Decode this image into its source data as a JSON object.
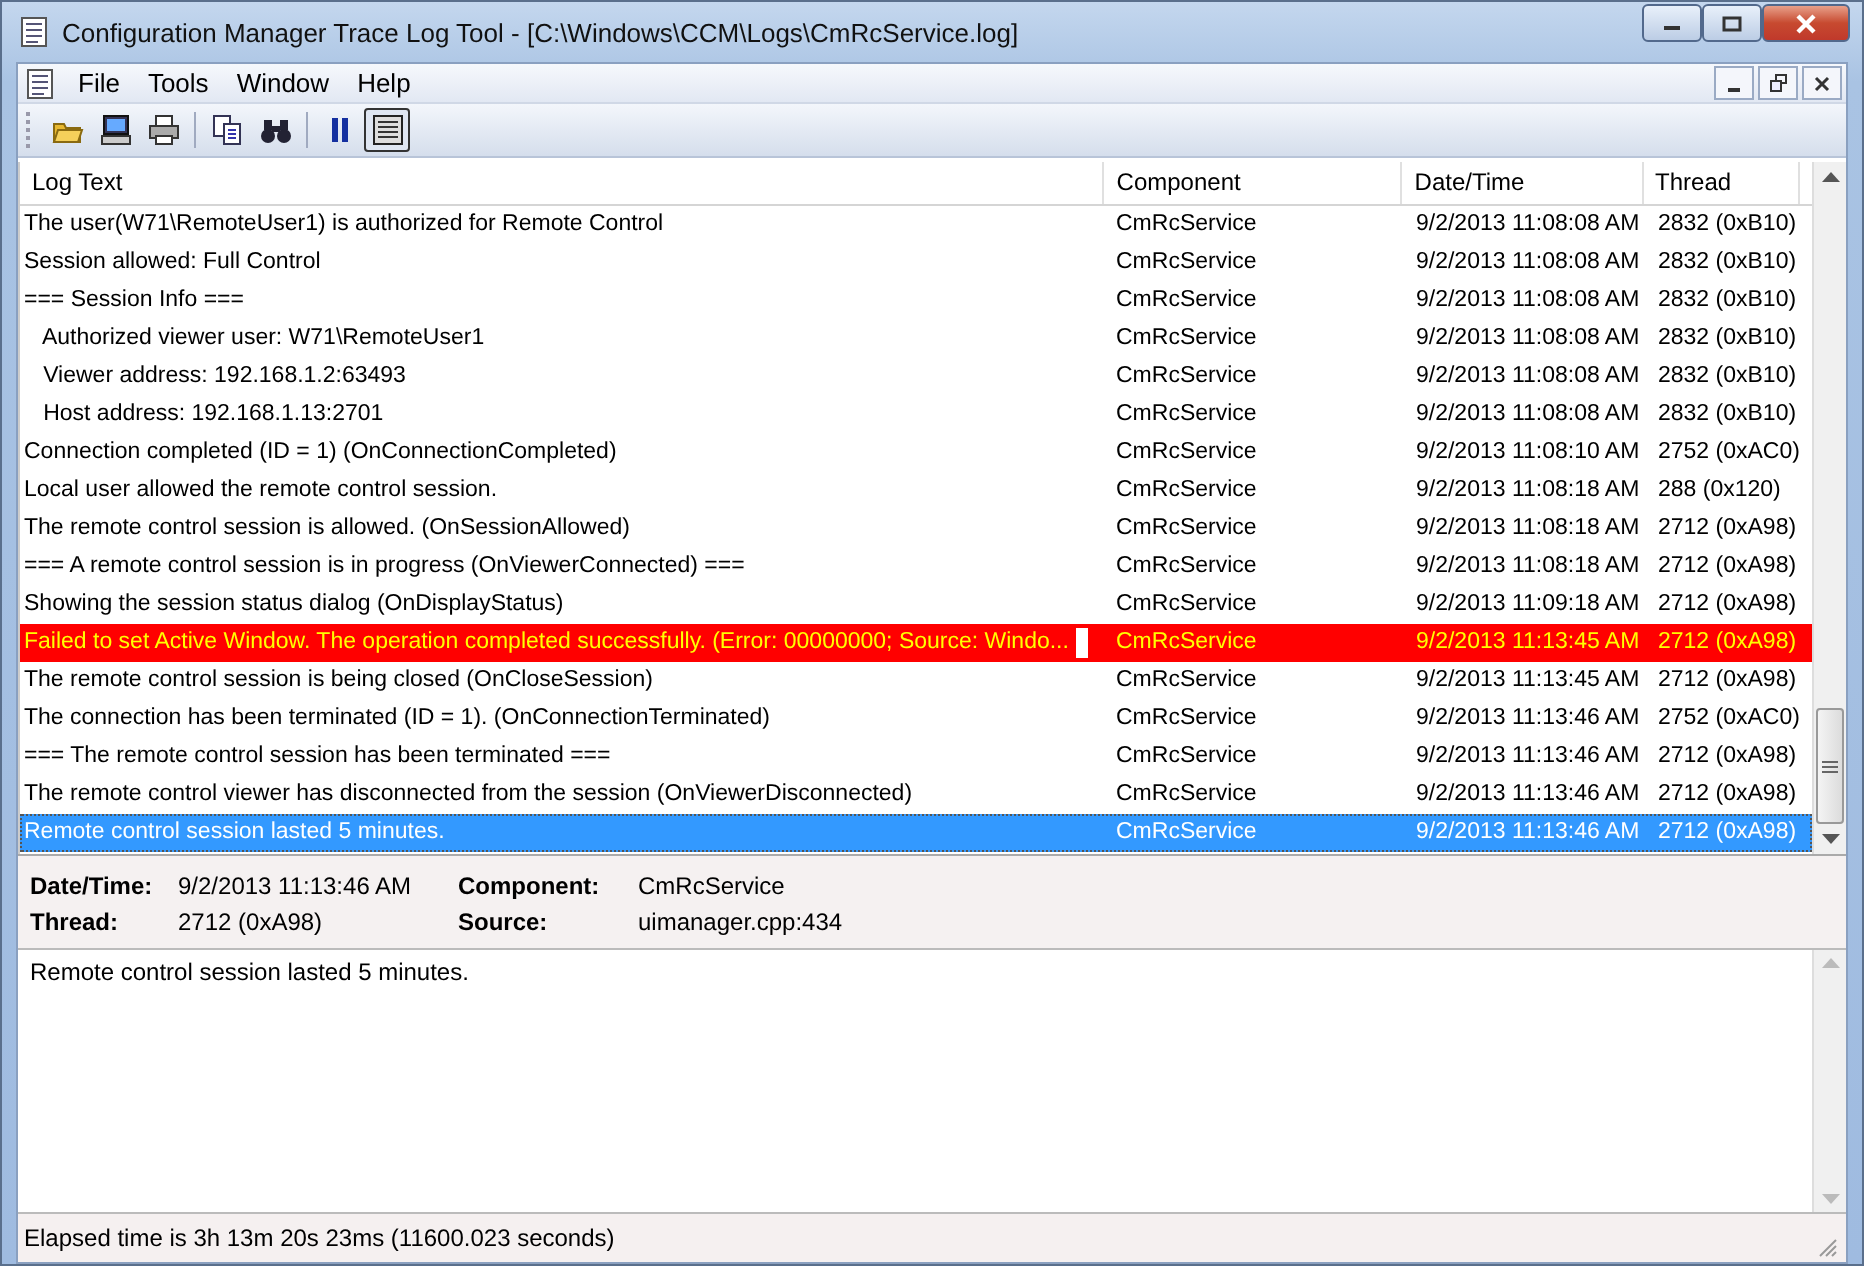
{
  "window": {
    "title": "Configuration Manager Trace Log Tool - [C:\\Windows\\CCM\\Logs\\CmRcService.log]"
  },
  "menu": [
    "File",
    "Tools",
    "Window",
    "Help"
  ],
  "toolbar": [
    {
      "pressed": false
    },
    {
      "pressed": false
    },
    {
      "pressed": false
    },
    {
      "pressed": false
    },
    {
      "pressed": false
    },
    {
      "pressed": false
    },
    {
      "pressed": true
    }
  ],
  "table": {
    "columns": [
      "Log Text",
      "Component",
      "Date/Time",
      "Thread"
    ],
    "rows": [
      {
        "text": "The user(W71\\RemoteUser1) is authorized for Remote Control",
        "component": "CmRcService",
        "datetime": "9/2/2013 11:08:08 AM",
        "thread": "2832 (0xB10)",
        "kind": "normal",
        "selected": false
      },
      {
        "text": "Session allowed: Full Control",
        "component": "CmRcService",
        "datetime": "9/2/2013 11:08:08 AM",
        "thread": "2832 (0xB10)",
        "kind": "normal",
        "selected": false
      },
      {
        "text": "=== Session Info ===",
        "component": "CmRcService",
        "datetime": "9/2/2013 11:08:08 AM",
        "thread": "2832 (0xB10)",
        "kind": "normal",
        "selected": false
      },
      {
        "text": "   Authorized viewer user: W71\\RemoteUser1",
        "component": "CmRcService",
        "datetime": "9/2/2013 11:08:08 AM",
        "thread": "2832 (0xB10)",
        "kind": "normal",
        "selected": false
      },
      {
        "text": "   Viewer address: 192.168.1.2:63493",
        "component": "CmRcService",
        "datetime": "9/2/2013 11:08:08 AM",
        "thread": "2832 (0xB10)",
        "kind": "normal",
        "selected": false
      },
      {
        "text": "   Host address: 192.168.1.13:2701",
        "component": "CmRcService",
        "datetime": "9/2/2013 11:08:08 AM",
        "thread": "2832 (0xB10)",
        "kind": "normal",
        "selected": false
      },
      {
        "text": "Connection completed (ID = 1) (OnConnectionCompleted)",
        "component": "CmRcService",
        "datetime": "9/2/2013 11:08:10 AM",
        "thread": "2752 (0xAC0)",
        "kind": "normal",
        "selected": false
      },
      {
        "text": "Local user allowed the remote control session.",
        "component": "CmRcService",
        "datetime": "9/2/2013 11:08:18 AM",
        "thread": "288 (0x120)",
        "kind": "normal",
        "selected": false
      },
      {
        "text": "The remote control session is allowed. (OnSessionAllowed)",
        "component": "CmRcService",
        "datetime": "9/2/2013 11:08:18 AM",
        "thread": "2712 (0xA98)",
        "kind": "normal",
        "selected": false
      },
      {
        "text": "=== A remote control session is in progress (OnViewerConnected) ===",
        "component": "CmRcService",
        "datetime": "9/2/2013 11:08:18 AM",
        "thread": "2712 (0xA98)",
        "kind": "normal",
        "selected": false
      },
      {
        "text": "Showing the session status dialog (OnDisplayStatus)",
        "component": "CmRcService",
        "datetime": "9/2/2013 11:09:18 AM",
        "thread": "2712 (0xA98)",
        "kind": "normal",
        "selected": false
      },
      {
        "text": "Failed to set Active Window. The operation completed successfully. (Error: 00000000; Source: Windo...",
        "component": "CmRcService",
        "datetime": "9/2/2013 11:13:45 AM",
        "thread": "2712 (0xA98)",
        "kind": "error",
        "selected": false
      },
      {
        "text": "The remote control session is being closed (OnCloseSession)",
        "component": "CmRcService",
        "datetime": "9/2/2013 11:13:45 AM",
        "thread": "2712 (0xA98)",
        "kind": "normal",
        "selected": false
      },
      {
        "text": "The connection has been terminated (ID = 1). (OnConnectionTerminated)",
        "component": "CmRcService",
        "datetime": "9/2/2013 11:13:46 AM",
        "thread": "2752 (0xAC0)",
        "kind": "normal",
        "selected": false
      },
      {
        "text": "=== The remote control session has been terminated ===",
        "component": "CmRcService",
        "datetime": "9/2/2013 11:13:46 AM",
        "thread": "2712 (0xA98)",
        "kind": "normal",
        "selected": false
      },
      {
        "text": "The remote control viewer has disconnected from the session (OnViewerDisconnected)",
        "component": "CmRcService",
        "datetime": "9/2/2013 11:13:46 AM",
        "thread": "2712 (0xA98)",
        "kind": "normal",
        "selected": false
      },
      {
        "text": "Remote control session lasted 5 minutes.",
        "component": "CmRcService",
        "datetime": "9/2/2013 11:13:46 AM",
        "thread": "2712 (0xA98)",
        "kind": "normal",
        "selected": true
      }
    ]
  },
  "details": {
    "fields": [
      {
        "label": "Date/Time:",
        "value": "9/2/2013 11:13:46 AM"
      },
      {
        "label": "Component:",
        "value": "CmRcService"
      },
      {
        "label": "Thread:",
        "value": "2712 (0xA98)"
      },
      {
        "label": "Source:",
        "value": "uimanager.cpp:434"
      }
    ],
    "message": "Remote control session lasted 5 minutes."
  },
  "status_bar": "Elapsed time is 3h 13m 20s 23ms (11600.023 seconds)"
}
